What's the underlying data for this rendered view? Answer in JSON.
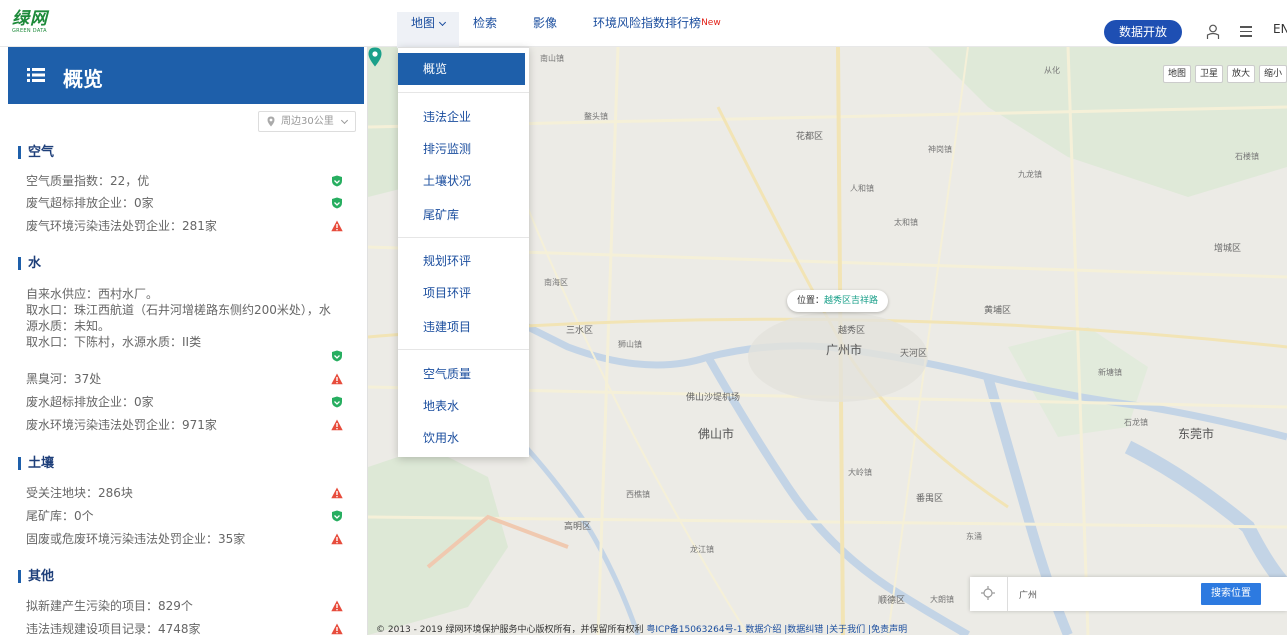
{
  "logo": {
    "main": "绿网",
    "sub": "GREEN DATA"
  },
  "nav": {
    "items": [
      {
        "label": "地图"
      },
      {
        "label": "检索"
      },
      {
        "label": "影像"
      },
      {
        "label": "环境风险指数排行榜",
        "badge": "New"
      }
    ],
    "open_data": "数据开放",
    "lang": "EN",
    "user_icon": "user-icon",
    "menu_icon": "menu-icon"
  },
  "colors": {
    "brand": "#1e5faa",
    "nav_text": "#1a4d9e",
    "ok": "#27ae60",
    "warn": "#e74c3c"
  },
  "sidebar": {
    "title": "概览",
    "range": "周边30公里",
    "sections": [
      {
        "title": "空气",
        "rows": [
          {
            "text": "空气质量指数：22，优",
            "status": "ok"
          },
          {
            "text": "废气超标排放企业：0家",
            "status": "ok"
          },
          {
            "text": "废气环境污染违法处罚企业：281家",
            "status": "warn"
          }
        ]
      },
      {
        "title": "水",
        "rows": [
          {
            "text": "自来水供应：西村水厂。",
            "status": ""
          },
          {
            "text": "取水口：珠江西航道（石井河增槎路东侧约200米处），水源水质：未知。",
            "status": ""
          },
          {
            "text": "取水口：下陈村，水源水质：II类",
            "status": "ok"
          },
          {
            "text": "黑臭河：37处",
            "status": "warn"
          },
          {
            "text": "废水超标排放企业：0家",
            "status": "ok"
          },
          {
            "text": "废水环境污染违法处罚企业：971家",
            "status": "warn"
          }
        ]
      },
      {
        "title": "土壤",
        "rows": [
          {
            "text": "受关注地块：286块",
            "status": "warn"
          },
          {
            "text": "尾矿库：0个",
            "status": "ok"
          },
          {
            "text": "固废或危废环境污染违法处罚企业：35家",
            "status": "warn"
          }
        ]
      },
      {
        "title": "其他",
        "rows": [
          {
            "text": "拟新建产生污染的项目：829个",
            "status": "warn"
          },
          {
            "text": "违法违规建设项目记录：4748家",
            "status": "warn"
          }
        ]
      }
    ]
  },
  "dropdown": {
    "items": [
      {
        "label": "概览",
        "selected": true
      },
      {
        "label": "违法企业"
      },
      {
        "label": "排污监测"
      },
      {
        "label": "土壤状况"
      },
      {
        "label": "尾矿库"
      },
      {
        "label": "规划环评"
      },
      {
        "label": "项目环评"
      },
      {
        "label": "违建项目"
      },
      {
        "label": "空气质量"
      },
      {
        "label": "地表水"
      },
      {
        "label": "饮用水"
      }
    ]
  },
  "map": {
    "controls": [
      "地图",
      "卫星",
      "放大",
      "缩小"
    ],
    "location_prefix": "位置：",
    "location_value": "越秀区吉祥路",
    "search_value": "广州",
    "search_button": "搜索位置",
    "footer_text": "© 2013 - 2019 绿网环境保护服务中心版权所有，并保留所有权利 ",
    "footer_links": "粤ICP备15063264号-1 数据介绍 |数据纠错 |关于我们 |免责声明",
    "labels": {
      "l1": "广州市",
      "l2": "佛山市",
      "l3": "东莞市",
      "l4": "花都区",
      "l5": "黄埔区",
      "l6": "番禺区",
      "l7": "天河区",
      "l8": "三水区",
      "l9": "增城区",
      "l10": "佛山沙堤机场",
      "l11": "高明区",
      "l12": "顺德区",
      "l13": "越秀区",
      "l14": "南山镇",
      "l15": "石楼镇",
      "l16": "新塘镇",
      "l17": "大朗镇",
      "l18": "东涌",
      "l19": "神岗镇",
      "l20": "太和镇",
      "l21": "人和镇",
      "l22": "龙江镇",
      "l23": "石龙镇",
      "l24": "九龙镇",
      "l25": "从化",
      "l26": "鳌头镇",
      "l27": "大岭镇",
      "l28": "南海区",
      "l29": "狮山镇",
      "l30": "西樵镇"
    }
  }
}
